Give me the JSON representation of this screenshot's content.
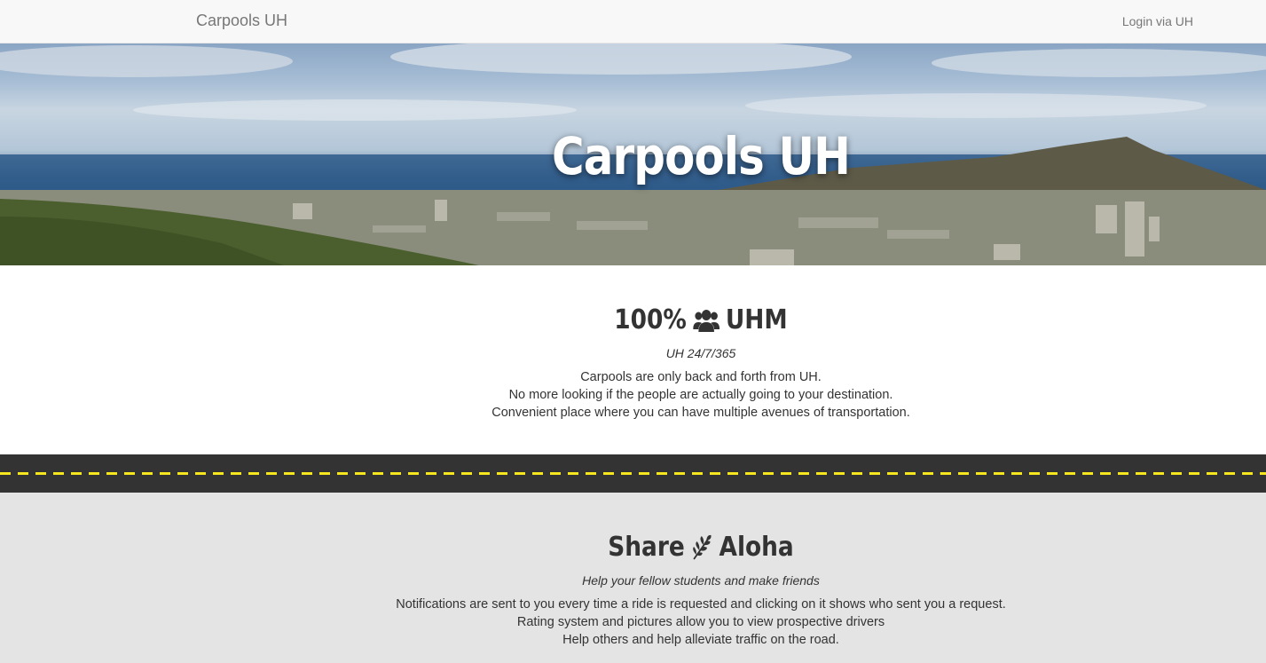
{
  "navbar": {
    "brand": "Carpools UH",
    "login": "Login via UH"
  },
  "hero": {
    "title": "Carpools UH"
  },
  "section_uhm": {
    "title_left": "100%",
    "icon": "users-icon",
    "title_right": "UHM",
    "subtitle": "UH 24/7/365",
    "lines": [
      "Carpools are only back and forth from UH.",
      "No more looking if the people are actually going to your destination.",
      "Convenient place where you can have multiple avenues of transportation."
    ]
  },
  "section_aloha": {
    "title_left": "Share",
    "icon": "leaf-icon",
    "title_right": "Aloha",
    "subtitle": "Help your fellow students and make friends",
    "lines": [
      "Notifications are sent to you every time a ride is requested and clicking on it shows who sent you a request.",
      "Rating system and pictures allow you to view prospective drivers",
      "Help others and help alleviate traffic on the road."
    ]
  },
  "colors": {
    "road": "#333333",
    "road_line": "#f6e61f",
    "section_alt_bg": "#e4e4e4"
  }
}
